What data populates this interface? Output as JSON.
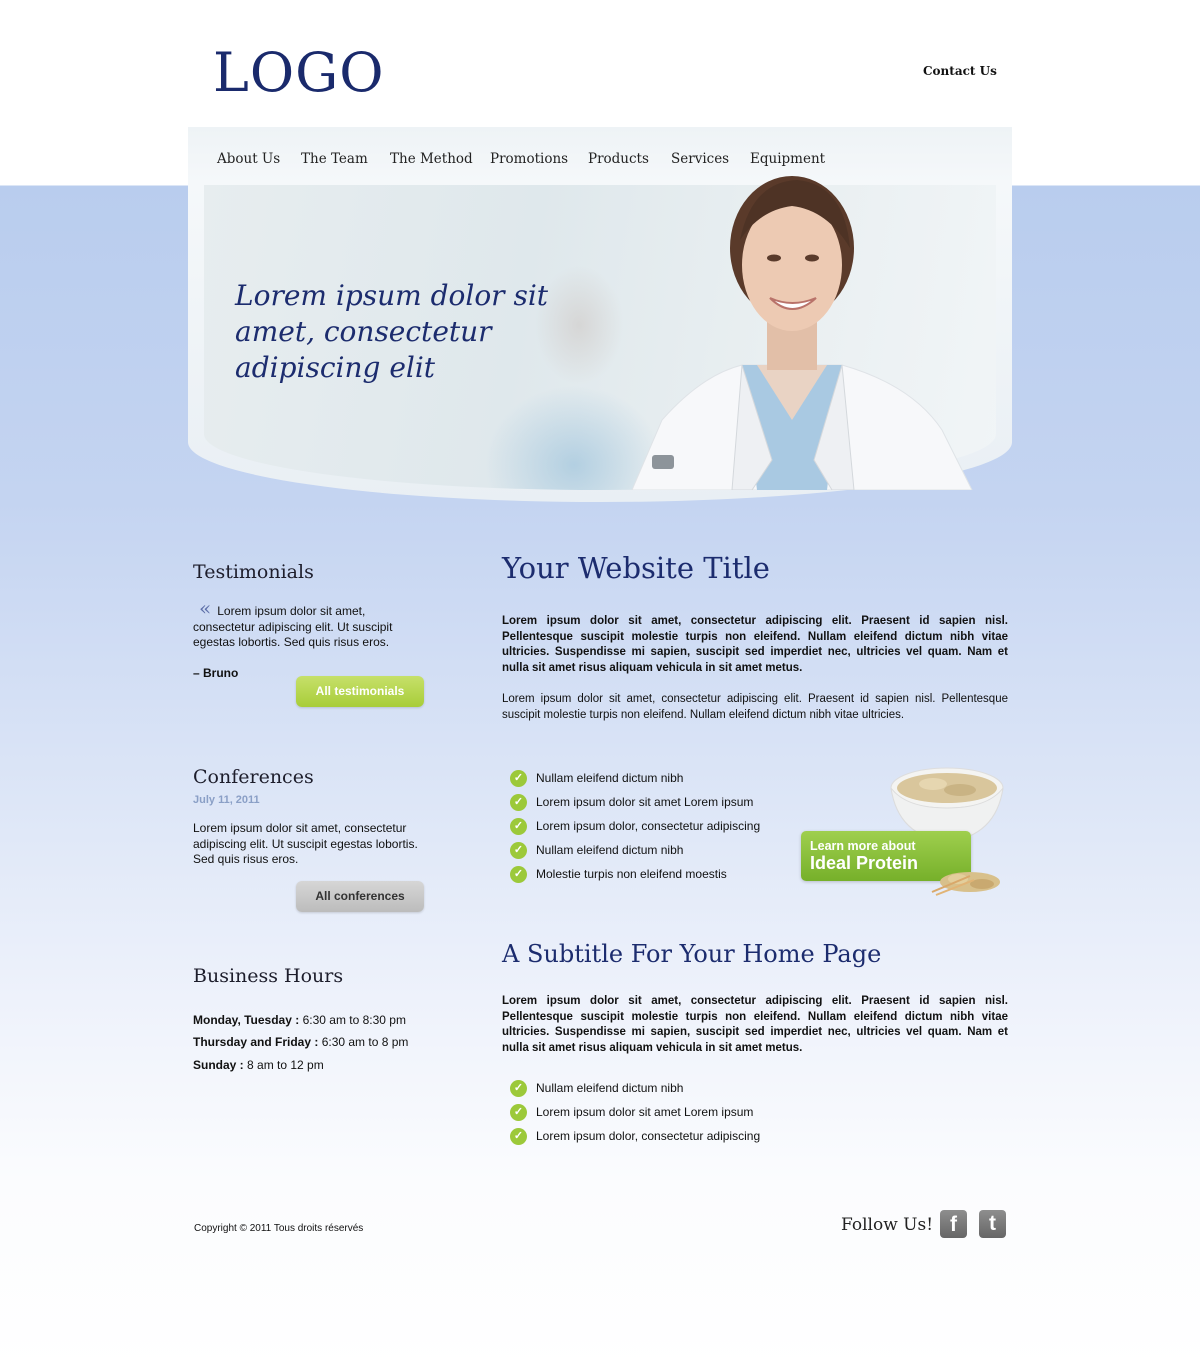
{
  "header": {
    "logo": "LOGO",
    "contact": "Contact Us"
  },
  "nav": [
    "About Us",
    "The Team",
    "The Method",
    "Promotions",
    "Products",
    "Services",
    "Equipment"
  ],
  "hero": {
    "headline": "Lorem ipsum dolor sit amet, consectetur adipiscing elit"
  },
  "sidebar": {
    "testimonials": {
      "title": "Testimonials",
      "quote": "Lorem ipsum dolor sit amet, consectetur adipiscing elit. Ut suscipit egestas lobortis. Sed quis risus eros.",
      "author": "– Bruno",
      "button": "All testimonials"
    },
    "conferences": {
      "title": "Conferences",
      "date": "July 11, 2011",
      "text": "Lorem ipsum dolor sit amet, consectetur adipiscing elit. Ut suscipit egestas lobortis. Sed quis risus eros.",
      "button": "All conferences"
    },
    "hours": {
      "title": "Business Hours",
      "rows": [
        {
          "days": "Monday, Tuesday :",
          "time": " 6:30 am to 8:30 pm"
        },
        {
          "days": "Thursday and Friday :",
          "time": " 6:30 am to 8 pm"
        },
        {
          "days": "Sunday :",
          "time": " 8 am to 12 pm"
        }
      ]
    }
  },
  "main": {
    "title": "Your Website Title",
    "para1": "Lorem ipsum dolor sit amet, consectetur adipiscing elit. Praesent id sapien nisl. Pellentesque suscipit molestie turpis non eleifend. Nullam eleifend dictum nibh vitae ultricies. Suspendisse mi sapien, suscipit sed imperdiet nec, ultricies vel quam. Nam et nulla sit amet risus aliquam vehicula in sit amet metus.",
    "para2": "Lorem ipsum dolor sit amet, consectetur adipiscing elit. Praesent id sapien nisl. Pellentesque suscipit molestie turpis non eleifend. Nullam eleifend dictum nibh vitae ultricies.",
    "list1": [
      "Nullam eleifend dictum nibh",
      "Lorem ipsum dolor sit amet Lorem ipsum",
      "Lorem ipsum dolor, consectetur adipiscing",
      "Nullam eleifend dictum nibh",
      "Molestie turpis non eleifend moestis"
    ],
    "promo": {
      "line1": "Learn more about",
      "line2": "Ideal Protein"
    },
    "subtitle": "A Subtitle For Your Home Page",
    "para3": "Lorem ipsum dolor sit amet, consectetur adipiscing elit. Praesent id sapien nisl. Pellentesque suscipit molestie turpis non eleifend. Nullam eleifend dictum nibh vitae ultricies. Suspendisse mi sapien, suscipit sed imperdiet nec, ultricies vel quam. Nam et nulla sit amet risus aliquam vehicula in sit amet metus.",
    "list2": [
      "Nullam eleifend dictum nibh",
      "Lorem ipsum dolor sit amet Lorem ipsum",
      "Lorem ipsum dolor, consectetur adipiscing"
    ]
  },
  "footer": {
    "copyright": "Copyright © 2011 Tous droits réservés",
    "follow": "Follow Us!",
    "social": [
      {
        "icon": "facebook-icon",
        "glyph": "f"
      },
      {
        "icon": "twitter-icon",
        "glyph": "t"
      }
    ]
  },
  "colors": {
    "accent_navy": "#1c2c6e",
    "accent_green": "#9cc93a",
    "background_blue": "#b9cdee"
  }
}
